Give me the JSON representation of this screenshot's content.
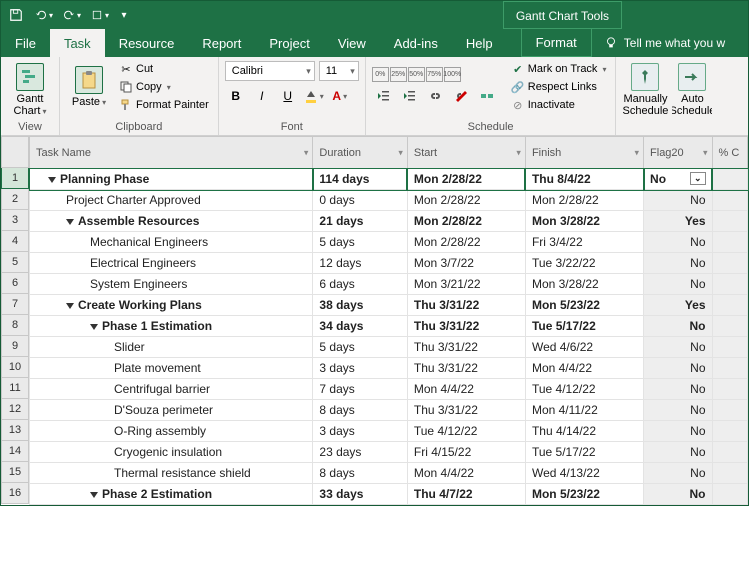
{
  "titlebar": {
    "tool_tab": "Gantt Chart Tools"
  },
  "tabs": {
    "file": "File",
    "task": "Task",
    "resource": "Resource",
    "report": "Report",
    "project": "Project",
    "view": "View",
    "addins": "Add-ins",
    "help": "Help",
    "format": "Format",
    "tellme": "Tell me what you w"
  },
  "ribbon": {
    "view": {
      "gantt": "Gantt Chart",
      "label": "View"
    },
    "clipboard": {
      "paste": "Paste",
      "cut": "Cut",
      "copy": "Copy",
      "painter": "Format Painter",
      "label": "Clipboard"
    },
    "font": {
      "name": "Calibri",
      "size": "11",
      "label": "Font"
    },
    "schedule": {
      "mark": "Mark on Track",
      "respect": "Respect Links",
      "inactivate": "Inactivate",
      "label": "Schedule"
    },
    "tasks_group": {
      "manual": "Manually Schedule",
      "auto": "Auto Schedule"
    }
  },
  "columns": {
    "name": "Task Name",
    "duration": "Duration",
    "start": "Start",
    "finish": "Finish",
    "flag": "Flag20",
    "pct": "% C"
  },
  "rows": [
    {
      "n": 1,
      "name": "Planning Phase",
      "dur": "114 days",
      "start": "Mon 2/28/22",
      "finish": "Thu 8/4/22",
      "flag": "No",
      "bold": true,
      "indent": 1,
      "toggle": true,
      "sel": true
    },
    {
      "n": 2,
      "name": "Project Charter Approved",
      "dur": "0 days",
      "start": "Mon 2/28/22",
      "finish": "Mon 2/28/22",
      "flag": "No",
      "indent": 2
    },
    {
      "n": 3,
      "name": "Assemble Resources",
      "dur": "21 days",
      "start": "Mon 2/28/22",
      "finish": "Mon 3/28/22",
      "flag": "Yes",
      "bold": true,
      "indent": 2,
      "toggle": true
    },
    {
      "n": 4,
      "name": "Mechanical Engineers",
      "dur": "5 days",
      "start": "Mon 2/28/22",
      "finish": "Fri 3/4/22",
      "flag": "No",
      "indent": 3
    },
    {
      "n": 5,
      "name": "Electrical Engineers",
      "dur": "12 days",
      "start": "Mon 3/7/22",
      "finish": "Tue 3/22/22",
      "flag": "No",
      "indent": 3
    },
    {
      "n": 6,
      "name": "System Engineers",
      "dur": "6 days",
      "start": "Mon 3/21/22",
      "finish": "Mon 3/28/22",
      "flag": "No",
      "indent": 3
    },
    {
      "n": 7,
      "name": "Create Working Plans",
      "dur": "38 days",
      "start": "Thu 3/31/22",
      "finish": "Mon 5/23/22",
      "flag": "Yes",
      "bold": true,
      "indent": 2,
      "toggle": true
    },
    {
      "n": 8,
      "name": "Phase 1 Estimation",
      "dur": "34 days",
      "start": "Thu 3/31/22",
      "finish": "Tue 5/17/22",
      "flag": "No",
      "bold": true,
      "indent": 3,
      "toggle": true
    },
    {
      "n": 9,
      "name": "Slider",
      "dur": "5 days",
      "start": "Thu 3/31/22",
      "finish": "Wed 4/6/22",
      "flag": "No",
      "indent": 4
    },
    {
      "n": 10,
      "name": "Plate movement",
      "dur": "3 days",
      "start": "Thu 3/31/22",
      "finish": "Mon 4/4/22",
      "flag": "No",
      "indent": 4
    },
    {
      "n": 11,
      "name": "Centrifugal barrier",
      "dur": "7 days",
      "start": "Mon 4/4/22",
      "finish": "Tue 4/12/22",
      "flag": "No",
      "indent": 4
    },
    {
      "n": 12,
      "name": "D'Souza perimeter",
      "dur": "8 days",
      "start": "Thu 3/31/22",
      "finish": "Mon 4/11/22",
      "flag": "No",
      "indent": 4
    },
    {
      "n": 13,
      "name": "O-Ring assembly",
      "dur": "3 days",
      "start": "Tue 4/12/22",
      "finish": "Thu 4/14/22",
      "flag": "No",
      "indent": 4
    },
    {
      "n": 14,
      "name": "Cryogenic insulation",
      "dur": "23 days",
      "start": "Fri 4/15/22",
      "finish": "Tue 5/17/22",
      "flag": "No",
      "indent": 4
    },
    {
      "n": 15,
      "name": "Thermal resistance shield",
      "dur": "8 days",
      "start": "Mon 4/4/22",
      "finish": "Wed 4/13/22",
      "flag": "No",
      "indent": 4
    },
    {
      "n": 16,
      "name": "Phase 2 Estimation",
      "dur": "33 days",
      "start": "Thu 4/7/22",
      "finish": "Mon 5/23/22",
      "flag": "No",
      "bold": true,
      "indent": 3,
      "toggle": true
    }
  ],
  "pct_values": [
    "0%",
    "25%",
    "50%",
    "75%",
    "100%"
  ]
}
